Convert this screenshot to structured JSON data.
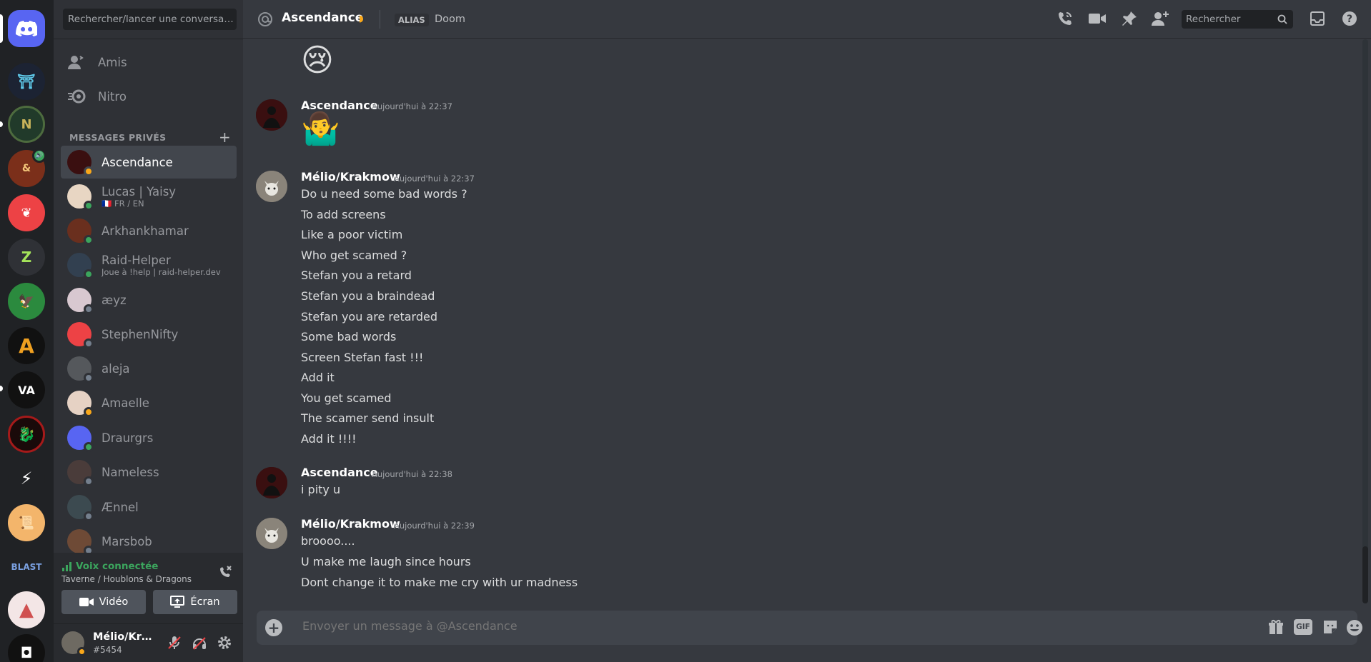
{
  "sidebar": {
    "search_placeholder": "Rechercher/lancer une conversati…",
    "nav": {
      "friends": "Amis",
      "nitro": "Nitro"
    },
    "dm_section_title": "MESSAGES PRIVÉS",
    "dms": [
      {
        "name": "Ascendance",
        "sub": "",
        "status": "idle",
        "avatar_color": "#3a0f10",
        "active": true
      },
      {
        "name": "Lucas | Yaisy",
        "sub": "🇫🇷 FR / EN",
        "status": "on",
        "avatar_color": "#e8d6c3",
        "active": false
      },
      {
        "name": "Arkhankhamar",
        "sub": "",
        "status": "on",
        "avatar_color": "#6a2f1e",
        "active": false
      },
      {
        "name": "Raid-Helper",
        "sub": "Joue à !help | raid-helper.dev",
        "status": "on",
        "avatar_color": "#324050",
        "active": false
      },
      {
        "name": "æyz",
        "sub": "",
        "status": "off",
        "avatar_color": "#d8c8d0",
        "active": false
      },
      {
        "name": "StephenNifty",
        "sub": "",
        "status": "off",
        "avatar_color": "#ed4245",
        "active": false
      },
      {
        "name": "aleja",
        "sub": "",
        "status": "off",
        "avatar_color": "#55585c",
        "active": false
      },
      {
        "name": "Amaelle",
        "sub": "",
        "status": "idle",
        "avatar_color": "#e6d2c4",
        "active": false
      },
      {
        "name": "Draurgrs",
        "sub": "",
        "status": "on",
        "avatar_color": "#5865f2",
        "active": false
      },
      {
        "name": "Nameless",
        "sub": "",
        "status": "off",
        "avatar_color": "#4a3c3a",
        "active": false
      },
      {
        "name": "Ænnel",
        "sub": "",
        "status": "off",
        "avatar_color": "#3c4a50",
        "active": false
      },
      {
        "name": "Marsbob",
        "sub": "",
        "status": "off",
        "avatar_color": "#6e4a36",
        "active": false
      }
    ],
    "voice": {
      "status": "Voix connectée",
      "channel": "Taverne / Houblons & Dragons",
      "video_label": "Vidéo",
      "screen_label": "Écran"
    },
    "user": {
      "name": "Mélio/Krak…",
      "tag": "#5454"
    }
  },
  "header": {
    "title": "Ascendance",
    "alias_label": "ALIAS",
    "alias_value": "Doom",
    "search_placeholder": "Rechercher"
  },
  "messages": {
    "top_emoji": "😢",
    "groups": [
      {
        "author": "Ascendance",
        "time": "Aujourd'hui à 22:37",
        "emoji": "🤷‍♂️",
        "lines": []
      },
      {
        "author": "Mélio/Krakmow",
        "time": "Aujourd'hui à 22:37",
        "emoji": "",
        "lines": [
          "Do u need some bad words ?",
          "To add screens",
          "Like a poor victim",
          "Who get scamed ?",
          "Stefan you a retard",
          "Stefan you a braindead",
          "Stefan you are retarded",
          "Some bad words",
          "Screen Stefan fast !!!",
          "Add it",
          "You get scamed",
          "The scamer send insult",
          "Add it !!!!"
        ]
      },
      {
        "author": "Ascendance",
        "time": "Aujourd'hui à 22:38",
        "emoji": "",
        "lines": [
          "i pity u"
        ]
      },
      {
        "author": "Mélio/Krakmow",
        "time": "Aujourd'hui à 22:39",
        "emoji": "",
        "lines": [
          "broooo....",
          "U make me laugh since hours",
          "Dont change it to make me cry with ur madness"
        ]
      }
    ]
  },
  "composer": {
    "placeholder": "Envoyer un message à @Ascendance",
    "gif_label": "GIF"
  },
  "colors": {
    "brand": "#5865f2",
    "online": "#3ba55d",
    "idle": "#faa81a",
    "offline": "#747f8d"
  }
}
